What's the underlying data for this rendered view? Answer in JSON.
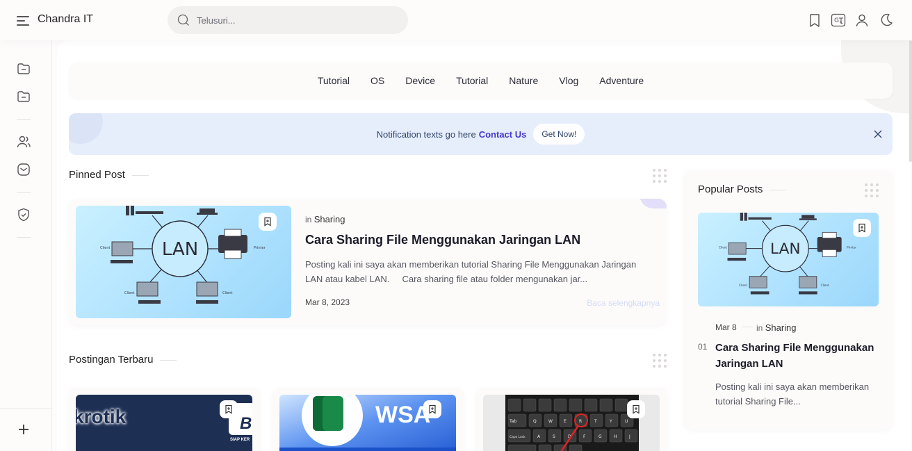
{
  "header": {
    "site_title": "Chandra IT",
    "search_placeholder": "Telusuri...",
    "icons": [
      "bookmark-icon",
      "translate-icon",
      "user-icon",
      "dark-mode-icon"
    ]
  },
  "sidebar": {
    "icons": [
      "folder-icon",
      "folder-icon",
      "users-icon",
      "mail-icon",
      "shield-check-icon",
      "plus-icon"
    ]
  },
  "categories": [
    "Tutorial",
    "OS",
    "Device",
    "Tutorial",
    "Nature",
    "Vlog",
    "Adventure"
  ],
  "notification": {
    "text": "Notification texts go here",
    "contact": "Contact Us",
    "button": "Get Now!"
  },
  "pinned": {
    "section_title": "Pinned Post",
    "in_label": "in",
    "category": "Sharing",
    "title": "Cara Sharing File Menggunakan Jaringan LAN",
    "excerpt": "Posting kali ini saya akan memberikan tutorial Sharing File Menggunakan Jaringan LAN atau kabel LAN.     Cara sharing file atau folder mengunakan jar...",
    "date": "Mar 8, 2023",
    "read_more": "Baca selengkapnya",
    "image_labels": {
      "center": "LAN",
      "printer": "Printer",
      "client": "Client"
    }
  },
  "recent": {
    "section_title": "Postingan Terbaru",
    "cards": [
      {
        "image_text": "krotik",
        "image_text2": "B",
        "image_small": "SIAP KER"
      },
      {
        "image_text": "WSA"
      },
      {
        "image_keys": [
          "Tab",
          "Q",
          "W",
          "E",
          "R",
          "T",
          "Y",
          "U",
          "Caps Lock",
          "A",
          "S",
          "D",
          "F",
          "G",
          "H",
          "J"
        ]
      }
    ]
  },
  "popular": {
    "section_title": "Popular Posts",
    "date": "Mar 8",
    "in_label": "in",
    "category": "Sharing",
    "number": "01",
    "title": "Cara Sharing File Menggunakan Jaringan LAN",
    "excerpt": "Posting kali ini saya akan memberikan tutorial Sharing File..."
  },
  "colors": {
    "accent": "#4437c8",
    "notif_bg": "#e6eefc",
    "page_bg": "#fdfcfb"
  }
}
